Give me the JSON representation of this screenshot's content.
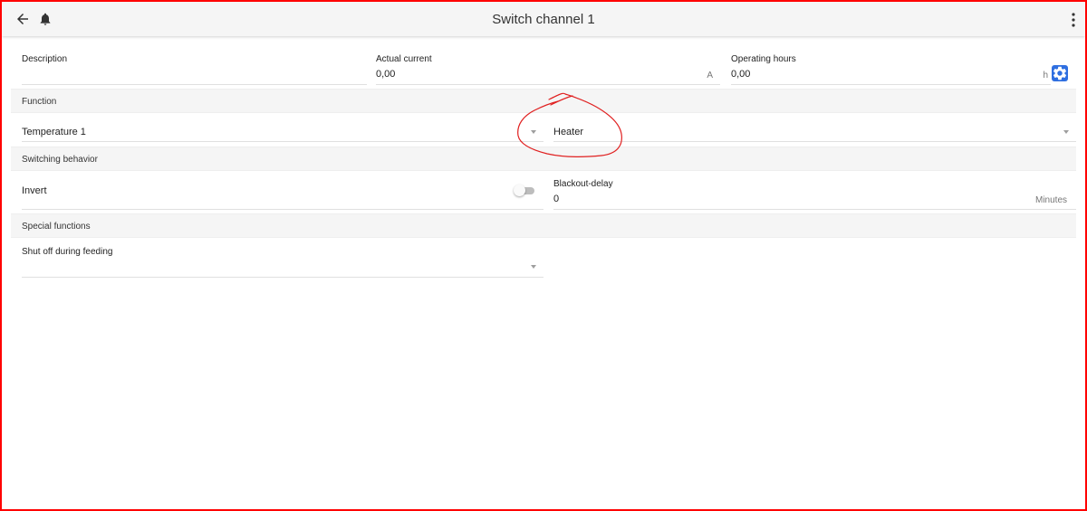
{
  "appbar": {
    "title": "Switch channel 1",
    "icons": [
      "arrow-left-icon",
      "bell-icon",
      "more-vert-icon"
    ]
  },
  "top_fields": {
    "description": {
      "label": "Description",
      "value": ""
    },
    "actual_current": {
      "label": "Actual current",
      "value": "0,00",
      "unit": "A"
    },
    "operating_hours": {
      "label": "Operating hours",
      "value": "0,00",
      "unit": "h",
      "action_icon": "gear-icon"
    }
  },
  "sections": {
    "function": {
      "title": "Function",
      "sensor_select": {
        "value": "Temperature 1"
      },
      "type_select": {
        "value": "Heater"
      }
    },
    "switching_behavior": {
      "title": "Switching behavior",
      "invert": {
        "label": "Invert",
        "checked": false
      },
      "blackout_delay": {
        "label": "Blackout-delay",
        "value": "0",
        "unit": "Minutes"
      }
    },
    "special_functions": {
      "title": "Special functions",
      "shut_off_during_feeding": {
        "label": "Shut off during feeding",
        "value": ""
      }
    }
  },
  "colors": {
    "appbar_bg": "#f5f5f5",
    "section_bg": "#f5f5f5",
    "accent_blue": "#2f6fe0",
    "annotation_red": "#e02020",
    "frame_red": "#ff0000"
  }
}
